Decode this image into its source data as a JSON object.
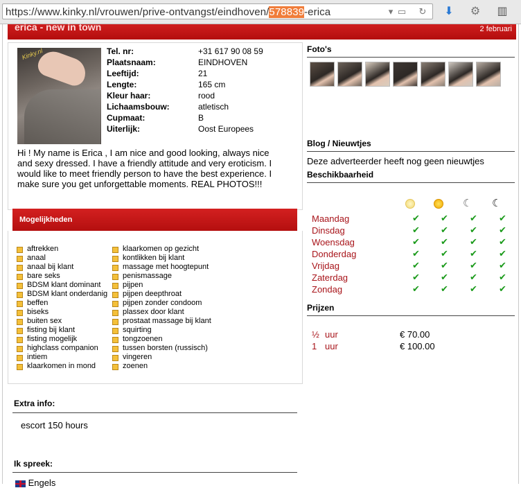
{
  "browser": {
    "url_before": "https://www.kinky.nl/vrouwen/prive-ontvangst/eindhoven/",
    "url_highlight": "578839",
    "url_after": "-erica"
  },
  "ad": {
    "title": "erica - new in town",
    "date": "2 februari",
    "photo_watermark": "Kinky.nl",
    "fields": [
      {
        "label": "Tel. nr:",
        "value": "+31 617 90 08 59"
      },
      {
        "label": "Plaatsnaam:",
        "value": "EINDHOVEN"
      },
      {
        "label": "Leeftijd:",
        "value": "21"
      },
      {
        "label": "Lengte:",
        "value": "165 cm"
      },
      {
        "label": "Kleur haar:",
        "value": "rood"
      },
      {
        "label": "Lichaamsbouw:",
        "value": "atletisch"
      },
      {
        "label": "Cupmaat:",
        "value": "B"
      },
      {
        "label": "Uiterlijk:",
        "value": "Oost Europees"
      }
    ],
    "description": "Hi ! My name is Erica , I am nice and good looking, always nice and sexy dressed. I have a friendly attitude and very eroticism. I would like to meet friendly person to have the best experience. I make sure you get unforgettable moments. REAL PHOTOS!!!"
  },
  "mogelijkheden": {
    "title": "Mogelijkheden",
    "col1": [
      "aftrekken",
      "anaal",
      "anaal bij klant",
      "bare seks",
      "BDSM klant dominant",
      "BDSM klant onderdanig",
      "beffen",
      "biseks",
      "buiten sex",
      "fisting bij klant",
      "fisting mogelijk",
      "highclass companion",
      "intiem",
      "klaarkomen in mond"
    ],
    "col2": [
      "klaarkomen op gezicht",
      "kontlikken bij klant",
      "massage met hoogtepunt",
      "penismassage",
      "pijpen",
      "pijpen deepthroat",
      "pijpen zonder condoom",
      "plassex door klant",
      "prostaat massage bij klant",
      "squirting",
      "tongzoenen",
      "tussen borsten (russisch)",
      "vingeren",
      "zoenen"
    ]
  },
  "extra_info": {
    "title": "Extra info:",
    "text": "escort 150 hours"
  },
  "languages": {
    "title": "Ik spreek:",
    "items": [
      "Engels"
    ]
  },
  "fotos": {
    "title": "Foto's",
    "count": 7
  },
  "blog": {
    "title": "Blog / Nieuwtjes",
    "text": "Deze adverteerder heeft nog geen nieuwtjes"
  },
  "beschikbaarheid": {
    "title": "Beschikbaarheid",
    "slots": [
      "morning-sun-icon",
      "afternoon-sun-icon",
      "evening-moon-icon",
      "night-moon-icon"
    ],
    "days": [
      "Maandag",
      "Dinsdag",
      "Woensdag",
      "Donderdag",
      "Vrijdag",
      "Zaterdag",
      "Zondag"
    ]
  },
  "prijzen": {
    "title": "Prijzen",
    "rows": [
      {
        "qty": "½",
        "unit": "uur",
        "price": "€ 70.00"
      },
      {
        "qty": "1",
        "unit": "uur",
        "price": "€ 100.00"
      }
    ]
  },
  "colors": {
    "accent": "#c41414",
    "link": "#a8141a",
    "check": "#1a9a1a"
  }
}
